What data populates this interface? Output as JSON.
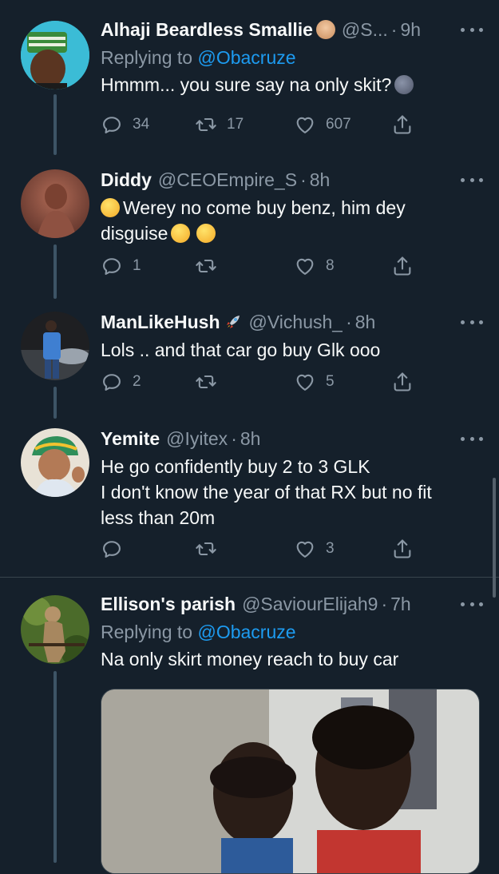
{
  "tweets": [
    {
      "name": "Alhaji Beardless Smallie",
      "handle": "@S...",
      "time": "9h",
      "replying_prefix": "Replying to",
      "replying_to": "@Obacruze",
      "text": "Hmmm... you sure say na only skit?",
      "replies": "34",
      "retweets": "17",
      "likes": "607",
      "name_emoji": "old-person-emoji",
      "text_emoji": "moon-face-emoji"
    },
    {
      "name": "Diddy",
      "handle": "@CEOEmpire_S",
      "time": "8h",
      "text_line1": "Werey no come buy benz, him dey",
      "text_line2": "disguise",
      "replies": "1",
      "retweets": "",
      "likes": "8"
    },
    {
      "name": "ManLikeHush",
      "handle": "@Vichush_",
      "time": "8h",
      "text": "Lols .. and that car go buy Glk ooo",
      "replies": "2",
      "retweets": "",
      "likes": "5",
      "name_emoji": "rocket-emoji"
    },
    {
      "name": "Yemite",
      "handle": "@Iyitex",
      "time": "8h",
      "text_line1": "He go confidently buy 2 to 3 GLK",
      "text_line2": "I don't know the year of that RX but no fit",
      "text_line3": "less than 20m",
      "replies": "",
      "retweets": "",
      "likes": "3"
    },
    {
      "name": "Ellison's parish",
      "handle": "@SaviourElijah9",
      "time": "7h",
      "replying_prefix": "Replying to",
      "replying_to": "@Obacruze",
      "text": "Na only skirt money reach to buy car"
    }
  ],
  "separator": "·",
  "colors": {
    "background": "#15202b",
    "text": "#f7f9f9",
    "muted": "#8b98a5",
    "link": "#1d9bf0",
    "divider": "#38444d"
  }
}
